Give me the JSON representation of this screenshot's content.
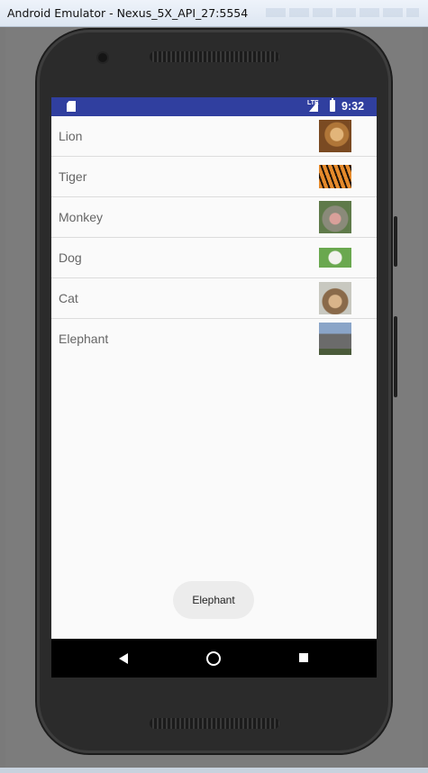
{
  "window": {
    "title": "Android Emulator - Nexus_5X_API_27:5554"
  },
  "statusbar": {
    "network_label": "LTE",
    "time": "9:32",
    "icons": [
      "sd-card-icon",
      "lte-signal-icon",
      "battery-charging-icon"
    ],
    "background": "#303f9f"
  },
  "list": {
    "items": [
      {
        "label": "Lion",
        "image": "lion-thumbnail"
      },
      {
        "label": "Tiger",
        "image": "tiger-thumbnail"
      },
      {
        "label": "Monkey",
        "image": "monkey-thumbnail"
      },
      {
        "label": "Dog",
        "image": "dog-thumbnail"
      },
      {
        "label": "Cat",
        "image": "cat-thumbnail"
      },
      {
        "label": "Elephant",
        "image": "elephant-thumbnail"
      }
    ]
  },
  "toast": {
    "text": "Elephant"
  },
  "navbar": {
    "buttons": [
      "back-icon",
      "home-icon",
      "recents-icon"
    ]
  }
}
